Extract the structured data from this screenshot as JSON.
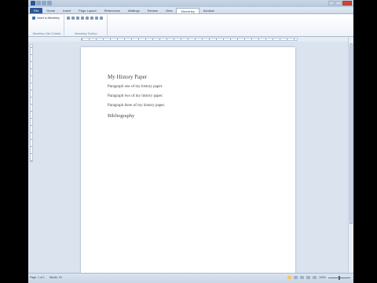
{
  "tabs": [
    "File",
    "Home",
    "Insert",
    "Page Layout",
    "References",
    "Mailings",
    "Review",
    "View",
    "Mendeley",
    "Acrobat"
  ],
  "active_tab_index": 8,
  "ribbon": {
    "insert_to_mendeley_label": "Insert to Mendeley",
    "group1_label": "Mendeley Cite-O-Matic",
    "group2_label": "Mendeley Toolbox"
  },
  "document": {
    "title": "My History Paper",
    "paragraphs": [
      "Paragraph one of my history paper.",
      "Paragraph two of my history paper.",
      "Paragraph three of my history paper."
    ],
    "heading": "Bibliography"
  },
  "statusbar": {
    "page": "Page: 1 of 1",
    "words": "Words: 20",
    "zoom": "100%"
  }
}
